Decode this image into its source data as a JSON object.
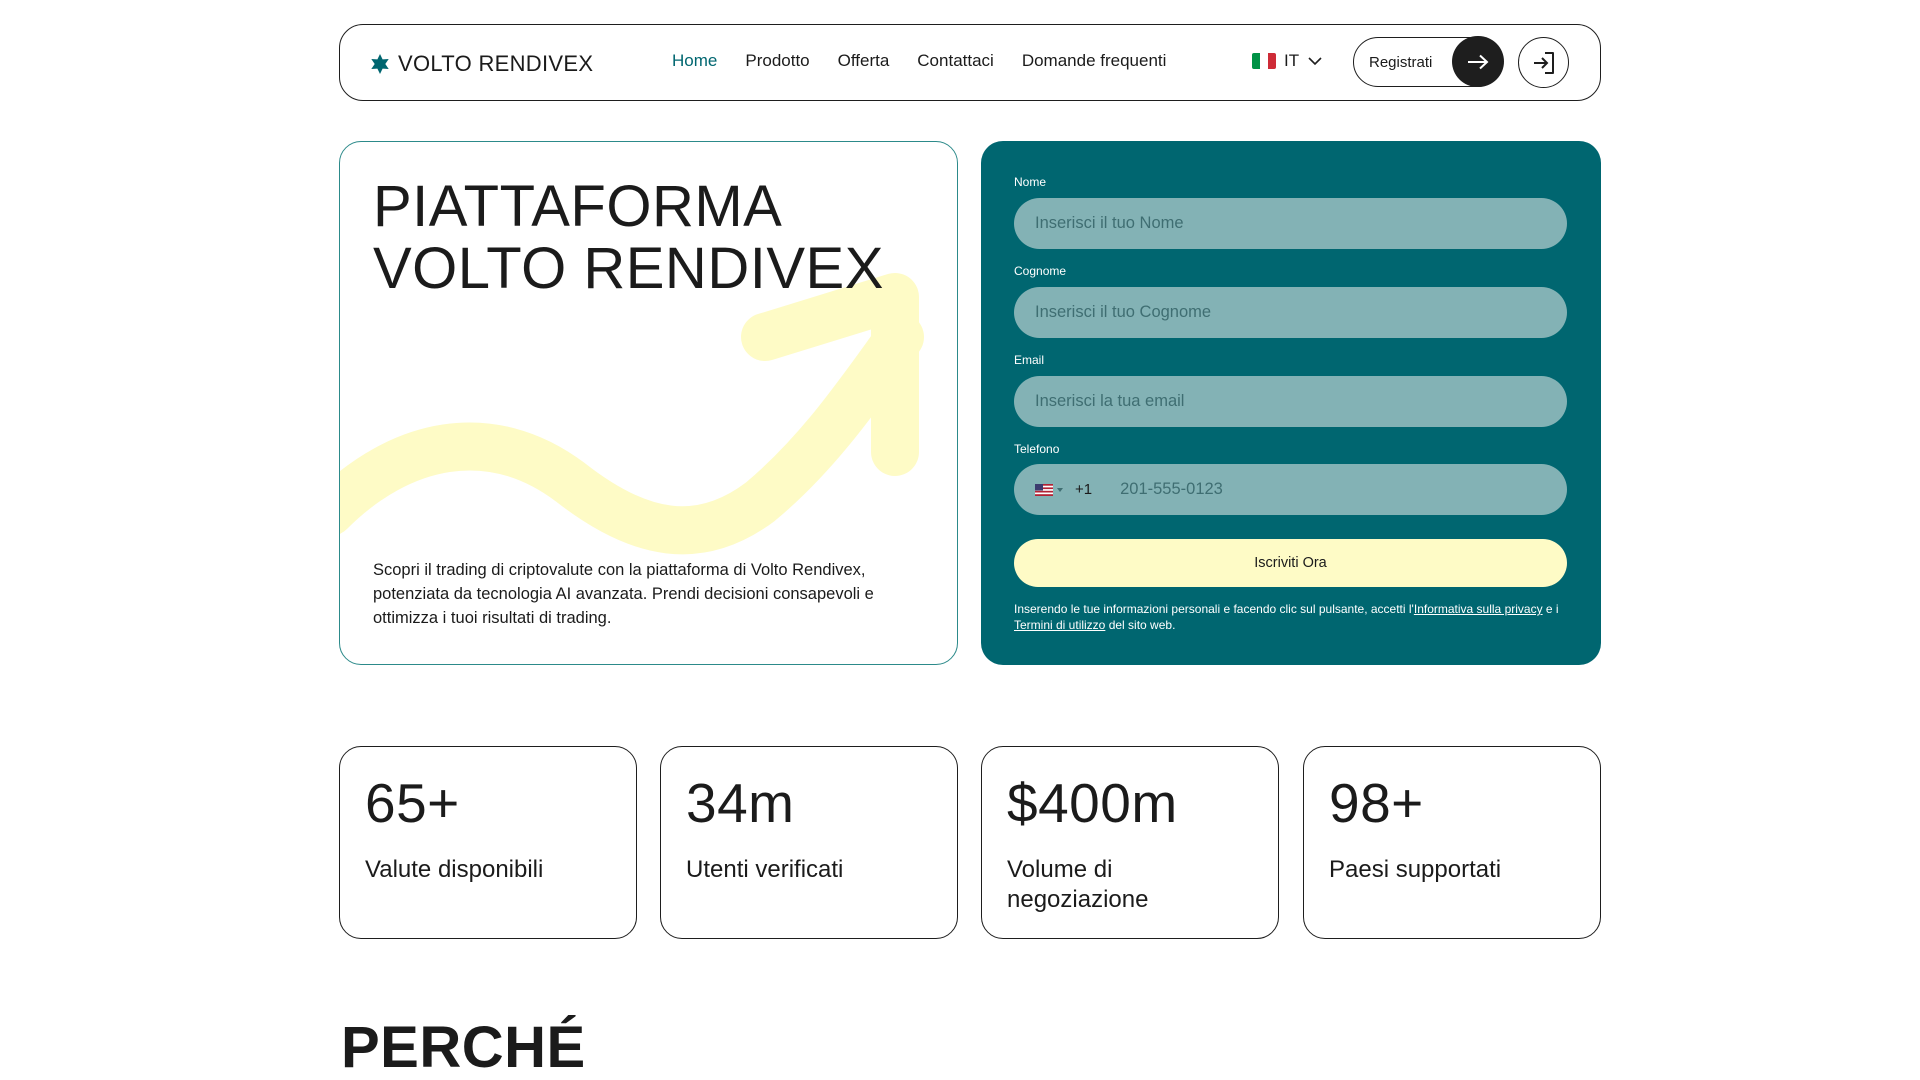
{
  "header": {
    "logo_text": "VOLTO RENDIVEX",
    "nav": [
      {
        "label": "Home",
        "active": true
      },
      {
        "label": "Prodotto"
      },
      {
        "label": "Offerta"
      },
      {
        "label": "Contattaci"
      },
      {
        "label": "Domande frequenti"
      }
    ],
    "language": "IT",
    "register_label": "Registrati"
  },
  "hero": {
    "title": "PIATTAFORMA\nVOLTO RENDIVEX",
    "description": "Scopri il trading di criptovalute con la piattaforma di Volto Rendivex, potenziata da tecnologia AI avanzata. Prendi decisioni consapevoli e ottimizza i tuoi risultati di trading."
  },
  "form": {
    "first_name_label": "Nome",
    "first_name_placeholder": "Inserisci il tuo Nome",
    "last_name_label": "Cognome",
    "last_name_placeholder": "Inserisci il tuo Cognome",
    "email_label": "Email",
    "email_placeholder": "Inserisci la tua email",
    "phone_label": "Telefono",
    "phone_code": "+1",
    "phone_placeholder": "201-555-0123",
    "submit_label": "Iscriviti Ora",
    "legal_prefix": "Inserendo le tue informazioni personali e facendo clic sul pulsante, accetti l'",
    "privacy_link": "Informativa sulla privacy",
    "legal_middle": " e i ",
    "terms_link": "Termini di utilizzo",
    "legal_suffix": " del sito web."
  },
  "stats": [
    {
      "value": "65+",
      "label": "Valute disponibili"
    },
    {
      "value": "34m",
      "label": "Utenti verificati"
    },
    {
      "value": "$400m",
      "label": "Volume di negoziazione"
    },
    {
      "value": "98+",
      "label": "Paesi supportati"
    }
  ],
  "section_title": "PERCHÉ",
  "colors": {
    "brand_teal": "#006670",
    "field_bg": "#83b2b5",
    "accent_cream": "#fefbc6",
    "ink": "#1b1b1b"
  }
}
